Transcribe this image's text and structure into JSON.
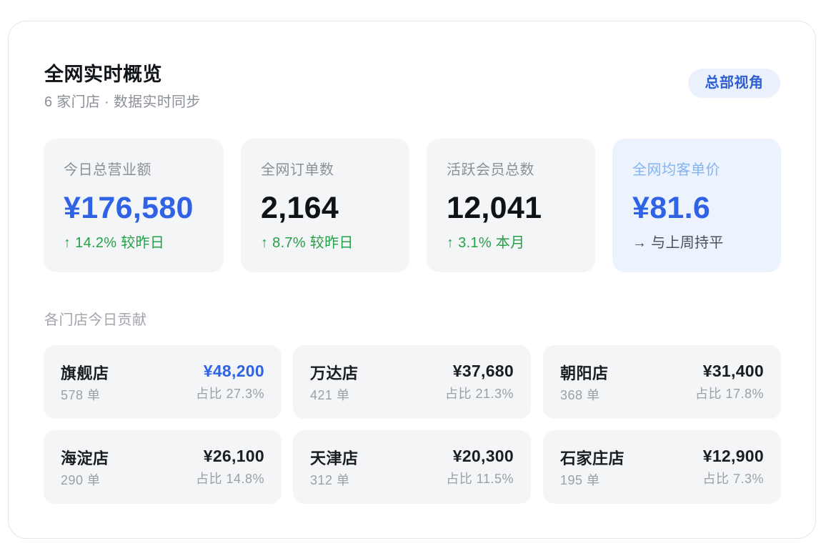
{
  "header": {
    "title": "全网实时概览",
    "subtitle": "6 家门店 · 数据实时同步",
    "badge": "总部视角"
  },
  "stats": [
    {
      "label": "今日总营业额",
      "value": "¥176,580",
      "trend": "↑ 14.2% 较昨日"
    },
    {
      "label": "全网订单数",
      "value": "2,164",
      "trend": "↑ 8.7% 较昨日"
    },
    {
      "label": "活跃会员总数",
      "value": "12,041",
      "trend": "↑ 3.1% 本月"
    },
    {
      "label": "全网均客单价",
      "value": "¥81.6",
      "trend": "→ 与上周持平"
    }
  ],
  "section": {
    "label": "各门店今日贡献"
  },
  "stores": [
    {
      "name": "旗舰店",
      "orders": "578 单",
      "amount": "¥48,200",
      "share": "占比 27.3%"
    },
    {
      "name": "万达店",
      "orders": "421 单",
      "amount": "¥37,680",
      "share": "占比 21.3%"
    },
    {
      "name": "朝阳店",
      "orders": "368 单",
      "amount": "¥31,400",
      "share": "占比 17.8%"
    },
    {
      "name": "海淀店",
      "orders": "290 单",
      "amount": "¥26,100",
      "share": "占比 14.8%"
    },
    {
      "name": "天津店",
      "orders": "312 单",
      "amount": "¥20,300",
      "share": "占比 11.5%"
    },
    {
      "name": "石家庄店",
      "orders": "195 单",
      "amount": "¥12,900",
      "share": "占比 7.3%"
    }
  ],
  "colors": {
    "accent": "#2f62e4",
    "positive": "#24a148",
    "badge_bg": "#eaf1fd",
    "highlight_bg": "#ecf3fe"
  }
}
